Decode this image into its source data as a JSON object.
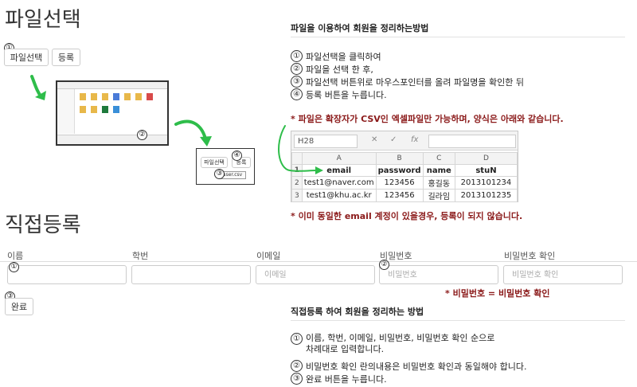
{
  "file_section": {
    "title": "파일선택",
    "select_button": "파일선택",
    "register_button": "등록",
    "marker1": "①",
    "marker2": "②",
    "marker3": "③",
    "marker4": "④",
    "popup_select_button": "파일선택",
    "popup_register_button": "등록",
    "popup_file_name": "user.csv"
  },
  "file_guide": {
    "heading": "파일을 이용하여 회원을 정리하는방법",
    "steps": [
      {
        "num": "①",
        "text": "파일선택을 클릭하여"
      },
      {
        "num": "②",
        "text": "파일을 선택 한 후,"
      },
      {
        "num": "③",
        "text": "파일선택 버튼위로 마우스포인터를 올려 파일명을 확인한 뒤"
      },
      {
        "num": "④",
        "text": "등록 버튼을 누릅니다."
      }
    ],
    "note1": "* 파일은 확장자가 CSV인 엑셀파일만 가능하며, 양식은 아래와 같습니다.",
    "note2": "* 이미 동일한 email 계정이 있을경우, 등록이 되지 않습니다."
  },
  "excel": {
    "cell_ref": "H28",
    "col_letters": [
      "A",
      "B",
      "C",
      "D"
    ],
    "header_row": {
      "num": "1",
      "cells": [
        "email",
        "password",
        "name",
        "stuN"
      ]
    },
    "rows": [
      {
        "num": "2",
        "cells": [
          "test1@naver.com",
          "123456",
          "홍길동",
          "2013101234"
        ]
      },
      {
        "num": "3",
        "cells": [
          "test1@khu.ac.kr",
          "123456",
          "길라임",
          "2013101235"
        ]
      }
    ]
  },
  "direct_section": {
    "title": "직접등록",
    "fields": {
      "name_label": "이름",
      "student_id_label": "학번",
      "email_label": "이메일",
      "email_placeholder": "이메일",
      "password_label": "비밀번호",
      "password_placeholder": "비밀번호",
      "password_confirm_label": "비밀번호 확인",
      "password_confirm_placeholder": "비밀번호 확인"
    },
    "marker1": "①",
    "marker2": "②",
    "marker3": "③",
    "password_note": "* 비밀번호 = 비밀번호 확인",
    "complete_button": "완료"
  },
  "direct_guide": {
    "heading": "직접등록 하여 회원을 정리하는 방법",
    "steps": [
      {
        "num": "①",
        "text": "이름, 학번, 이메일, 비밀번호, 비밀번호 확인 순으로",
        "text2": "차례대로 입력합니다."
      },
      {
        "num": "②",
        "text": "비밀번호 확인 란의내용은 비밀번호 확인과 동일해야 합니다."
      },
      {
        "num": "③",
        "text": "완료 버튼을 누릅니다."
      }
    ]
  },
  "colors": {
    "arrow_green": "#2ebd4a",
    "note_red": "#8b1a1a"
  }
}
